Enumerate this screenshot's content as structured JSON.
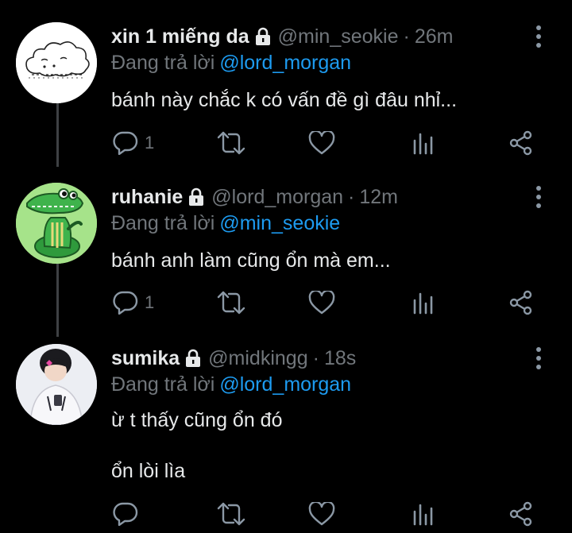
{
  "tweets": [
    {
      "name": "xin 1 miếng da",
      "handle": "@min_seokie",
      "dot": "·",
      "time": "26m",
      "reply_prefix": "Đang trả lời",
      "reply_to": "@lord_morgan",
      "text_lines": [
        "bánh này chắc k có vấn đề gì đâu nhỉ..."
      ],
      "reply_count": "1",
      "avatar": "cloud-sketch-avatar"
    },
    {
      "name": "ruhanie",
      "handle": "@lord_morgan",
      "dot": "·",
      "time": "12m",
      "reply_prefix": "Đang trả lời",
      "reply_to": "@min_seokie",
      "text_lines": [
        "bánh anh làm cũng ổn mà em..."
      ],
      "reply_count": "1",
      "avatar": "green-crocodile-avatar"
    },
    {
      "name": "sumika",
      "handle": "@midkingg",
      "dot": "·",
      "time": "18s",
      "reply_prefix": "Đang trả lời",
      "reply_to": "@lord_morgan",
      "text_lines": [
        "ừ t thấy cũng ổn đó",
        "ổn lòi lìa"
      ],
      "reply_count": "",
      "avatar": "person-photo-avatar"
    }
  ],
  "colors": {
    "background": "#000000",
    "text": "#e7e9ea",
    "muted": "#71767b",
    "accent": "#1d9bf0",
    "thread_line": "#3e4144"
  },
  "icons": [
    "lock-icon",
    "more-vertical-icon",
    "reply-icon",
    "retweet-icon",
    "like-icon",
    "analytics-icon",
    "share-icon"
  ]
}
